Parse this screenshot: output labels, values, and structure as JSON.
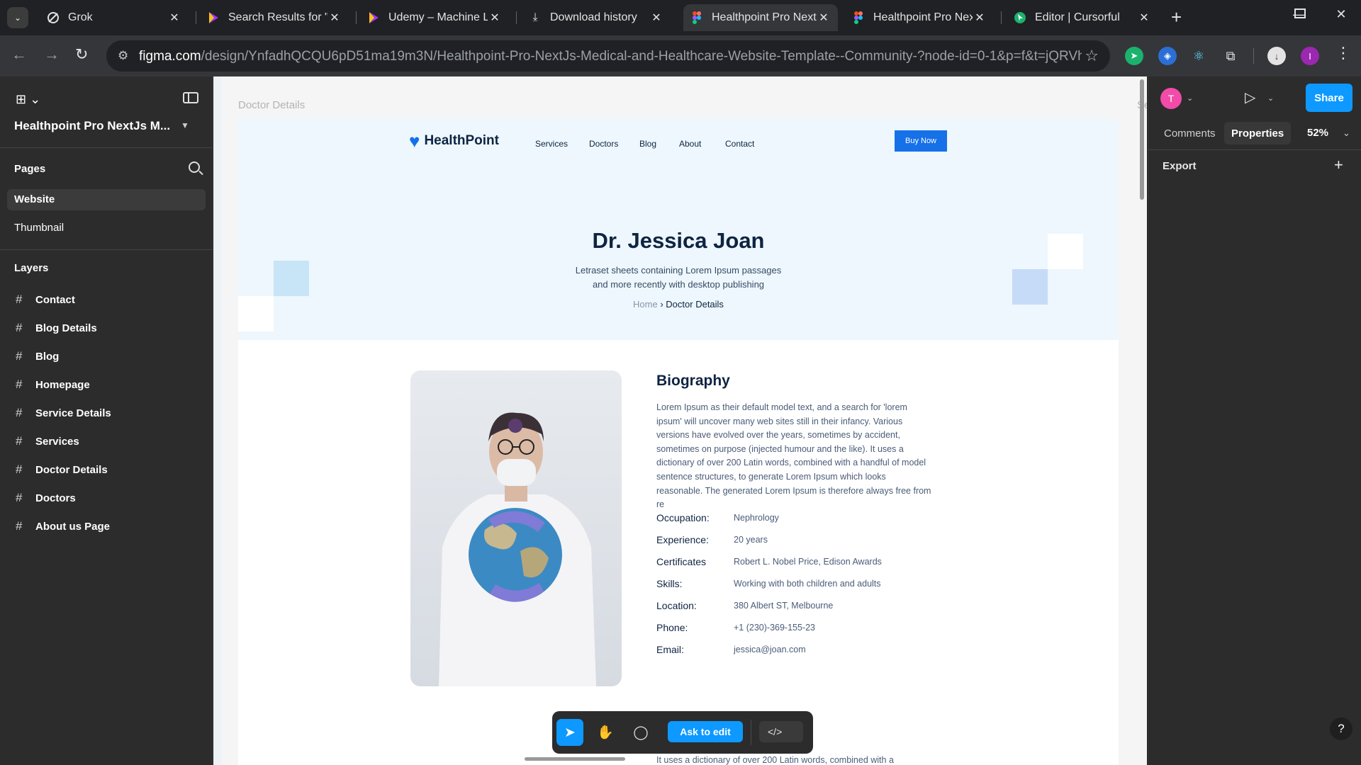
{
  "browser": {
    "tabs": [
      {
        "title": "Grok",
        "icon": "grok-icon"
      },
      {
        "title": "Search Results for \"Mach",
        "icon": "udemy-icon"
      },
      {
        "title": "Udemy – Machine Learning",
        "icon": "udemy-icon"
      },
      {
        "title": "Download history",
        "icon": "download-icon"
      },
      {
        "title": "Healthpoint Pro NextJs",
        "icon": "figma-icon"
      },
      {
        "title": "Healthpoint Pro NextJs",
        "icon": "figma-icon"
      },
      {
        "title": "Editor | Cursorful",
        "icon": "cursorful-icon"
      }
    ],
    "active_tab": 4,
    "url_domain": "figma.com",
    "url_path": "/design/YnfadhQCQU6pD51ma19m3N/Healthpoint-Pro-NextJs-Medical-and-Healthcare-Website-Template--Community-?node-id=0-1&p=f&t=jQRVhxpzCH...",
    "profile_initial": "I"
  },
  "figma": {
    "file_name": "Healthpoint Pro NextJs M...",
    "pages_heading": "Pages",
    "pages": [
      "Website",
      "Thumbnail"
    ],
    "selected_page": "Website",
    "layers_heading": "Layers",
    "layers": [
      "Contact",
      "Blog Details",
      "Blog",
      "Homepage",
      "Service Details",
      "Services",
      "Doctor Details",
      "Doctors",
      "About us Page"
    ],
    "frame_label": "Doctor Details",
    "frame_label_right": "Se",
    "user_initial": "T",
    "share_label": "Share",
    "tab_comments": "Comments",
    "tab_properties": "Properties",
    "zoom": "52%",
    "export_label": "Export",
    "ask_to_edit": "Ask to edit",
    "help": "?"
  },
  "site": {
    "brand": "HealthPoint",
    "nav": [
      "Services",
      "Doctors",
      "Blog",
      "About",
      "Contact"
    ],
    "buy_label": "Buy Now",
    "title": "Dr. Jessica Joan",
    "subtitle_line1": "Letraset sheets containing Lorem Ipsum passages",
    "subtitle_line2": "and more recently with desktop publishing",
    "crumb_home": "Home",
    "crumb_sep": " › ",
    "crumb_current": "Doctor Details",
    "bio_heading": "Biography",
    "bio_text": "Lorem Ipsum as their default model text, and a search for 'lorem ipsum' will uncover many web sites still in their infancy. Various versions have evolved over the years, sometimes by accident, sometimes on purpose (injected humour and the like). It uses a dictionary of over 200 Latin words, combined with a handful of model sentence structures, to generate Lorem Ipsum which looks reasonable. The generated Lorem Ipsum is therefore always free from re",
    "info": [
      {
        "k": "Occupation:",
        "v": "Nephrology"
      },
      {
        "k": "Experience:",
        "v": "20 years"
      },
      {
        "k": "Certificates",
        "v": "Robert L. Nobel Price, Edison Awards"
      },
      {
        "k": "Skills:",
        "v": "Working with both children and adults"
      },
      {
        "k": "Location:",
        "v": "380 Albert ST, Melbourne"
      },
      {
        "k": "Phone:",
        "v": "+1 (230)-369-155-23"
      },
      {
        "k": "Email:",
        "v": "jessica@joan.com"
      }
    ],
    "bottom_text": "It uses a dictionary of over 200 Latin words, combined with a"
  },
  "colors": {
    "brand_blue": "#1671e8",
    "figma_blue": "#0d99ff",
    "hero_bg": "#edf7fd",
    "dark_navy": "#0e2441"
  }
}
